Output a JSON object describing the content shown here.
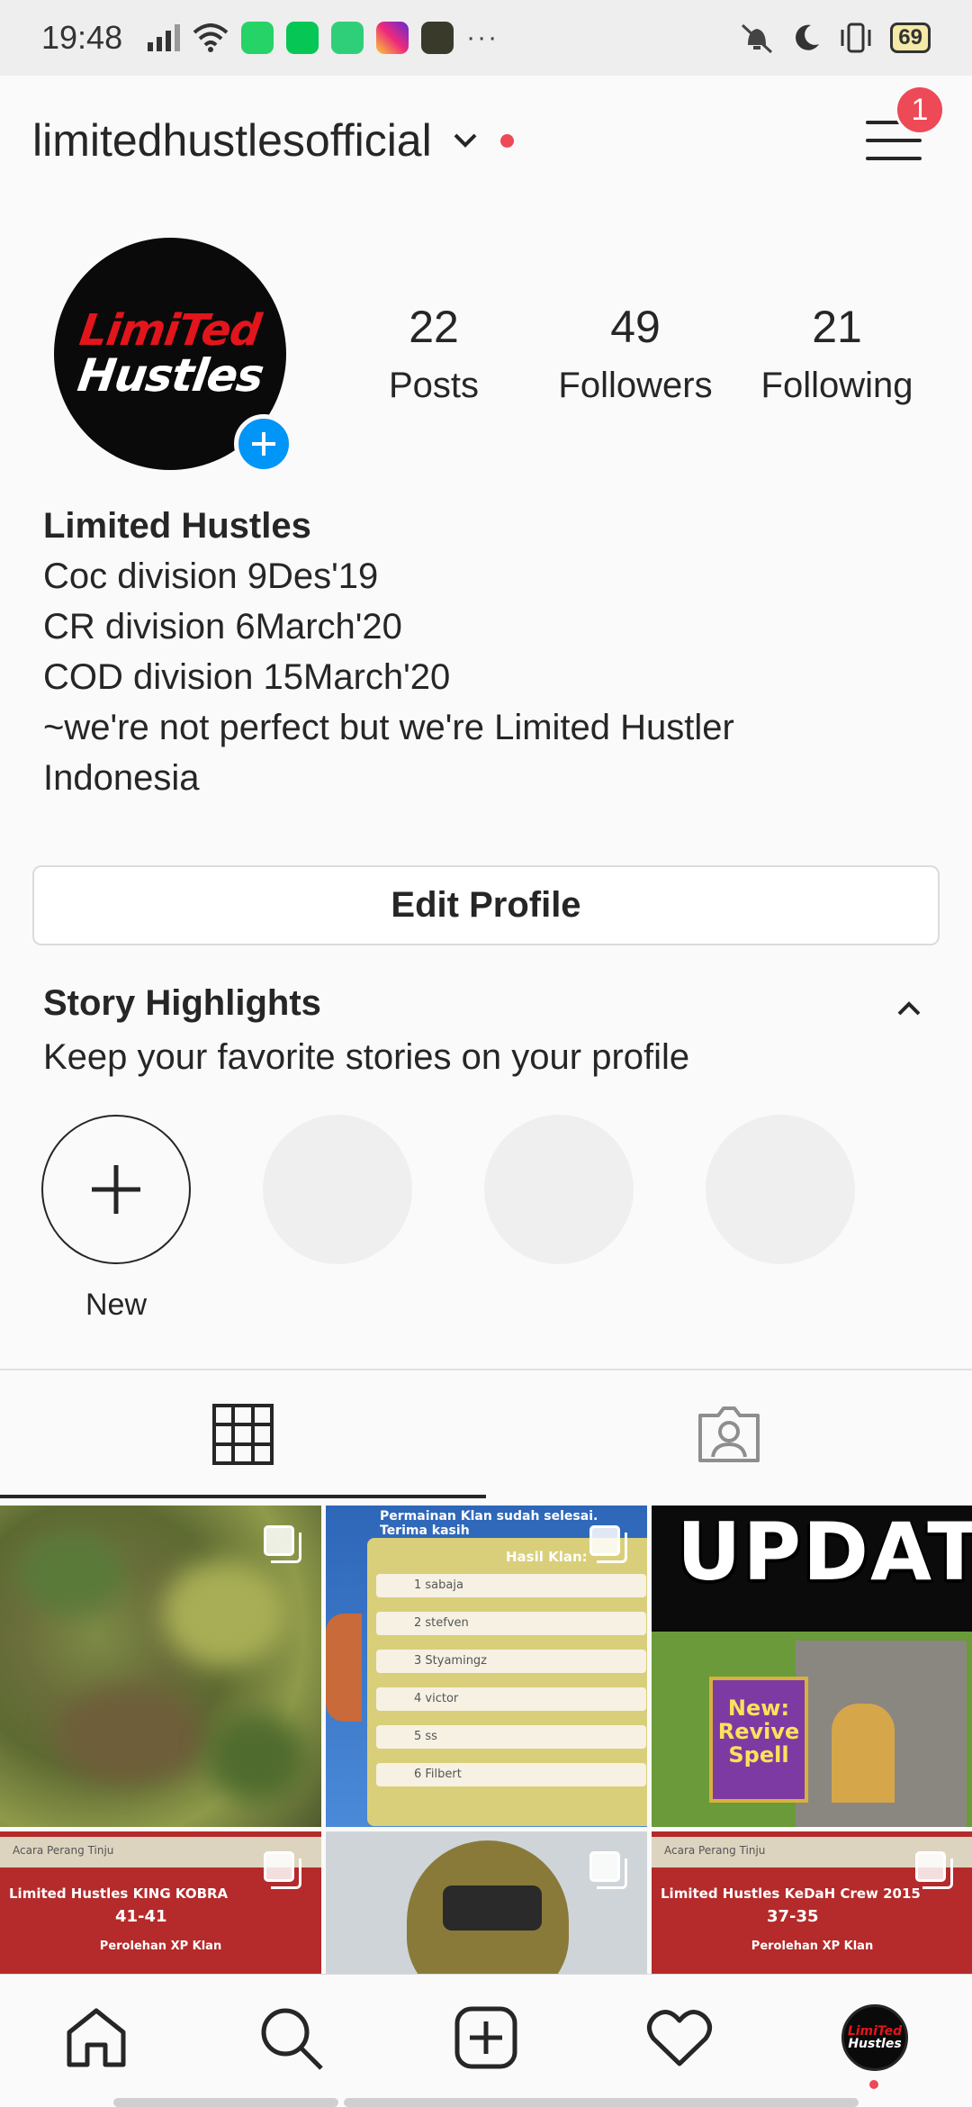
{
  "status_bar": {
    "time": "19:48",
    "battery": "69",
    "more": "···"
  },
  "header": {
    "username": "limitedhustlesofficial",
    "menu_badge": "1"
  },
  "profile": {
    "logo_line1": "LimiTed",
    "logo_line2": "Hustles",
    "stats": [
      {
        "value": "22",
        "label": "Posts"
      },
      {
        "value": "49",
        "label": "Followers"
      },
      {
        "value": "21",
        "label": "Following"
      }
    ],
    "bio": {
      "name": "Limited Hustles",
      "lines": [
        "Coc division 9Des'19",
        "CR division 6March'20",
        "COD division 15March'20",
        "~we're not perfect but we're Limited Hustler",
        "Indonesia"
      ]
    },
    "edit_button": "Edit Profile"
  },
  "highlights": {
    "title": "Story Highlights",
    "subtitle": "Keep your favorite stories on your profile",
    "new_label": "New"
  },
  "grid": {
    "tile2": {
      "header": "Permainan Klan sudah selesai. Terima kasih",
      "subheader": "Hasil Klan:",
      "rows": [
        "1  sabaja",
        "2  stefven",
        "3  Styamingz",
        "4  victor",
        "5  ss",
        "6  Filbert"
      ]
    },
    "tile3": {
      "title": "UPDAT",
      "banner": "New: Revive Spell"
    },
    "tile4": {
      "tabs": "Acara Perang     Tinju",
      "teams": "Limited Hustles   KING KOBRA",
      "score": "41-41",
      "sub": "Perolehan XP Klan"
    },
    "tile6": {
      "tabs": "Acara Perang     Tinju",
      "teams": "Limited Hustles   KeDaH Crew 2015",
      "score": "37-35",
      "sub": "Perolehan XP Klan"
    }
  }
}
